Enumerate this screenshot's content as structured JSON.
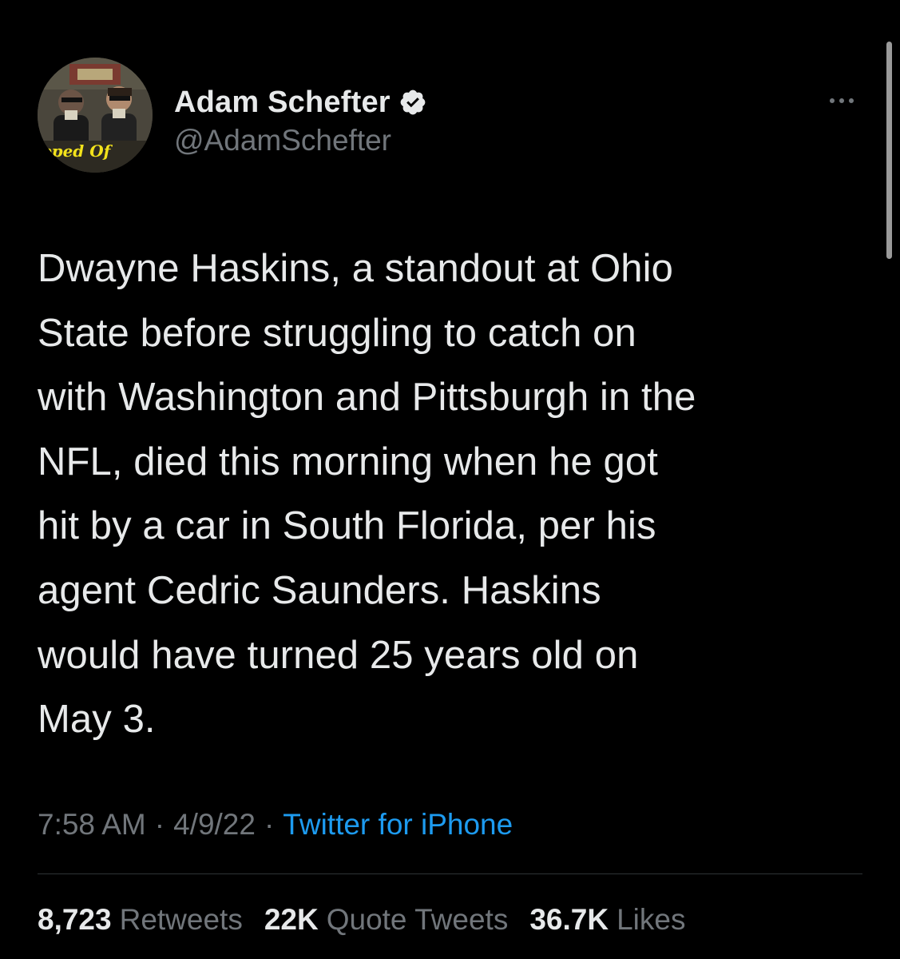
{
  "colors": {
    "background": "#000000",
    "primary_text": "#e7e9ea",
    "secondary_text": "#71767b",
    "link": "#1d9bf0",
    "divider": "#2f3336",
    "verified_badge": "#e7e9ea"
  },
  "author": {
    "display_name": "Adam Schefter",
    "handle": "@AdamSchefter",
    "verified": true,
    "verified_icon": "verified-badge-icon",
    "avatar_text": "ipped Of"
  },
  "more_menu": {
    "icon": "more-horizontal-icon"
  },
  "tweet": {
    "lines": [
      "Dwayne Haskins, a standout at Ohio",
      "State before struggling to catch on",
      "with Washington and Pittsburgh in the",
      "NFL, died this morning when he got",
      "hit by a car in South Florida, per his",
      "agent Cedric Saunders. Haskins",
      "would have turned 25 years old on",
      "May 3."
    ]
  },
  "meta": {
    "time": "7:58 AM",
    "separator": "·",
    "date": "4/9/22",
    "source": "Twitter for iPhone"
  },
  "stats": [
    {
      "value": "8,723",
      "label": "Retweets"
    },
    {
      "value": "22K",
      "label": "Quote Tweets"
    },
    {
      "value": "36.7K",
      "label": "Likes"
    }
  ]
}
